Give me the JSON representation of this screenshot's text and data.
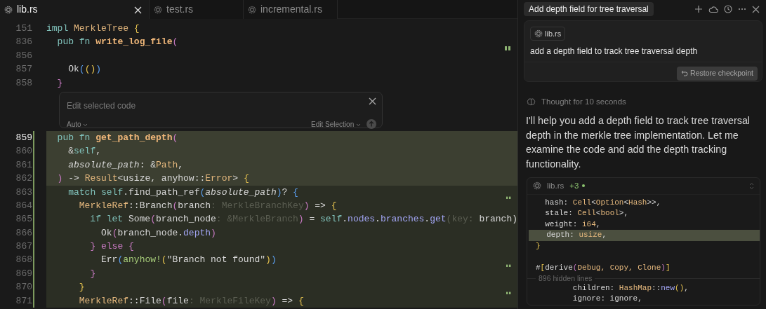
{
  "tabs": [
    {
      "label": "lib.rs",
      "selected": true,
      "closable": true
    },
    {
      "label": "test.rs",
      "selected": false
    },
    {
      "label": "incremental.rs",
      "selected": false
    }
  ],
  "editor": {
    "lines_before": [
      {
        "number": "151",
        "tokens": [
          {
            "text": "impl",
            "kind": "kw"
          },
          {
            "text": " MerkleTree",
            "kind": "type"
          },
          {
            "text": " {",
            "kind": "yellow"
          }
        ]
      },
      {
        "number": "836",
        "marker": true,
        "tokens": [
          {
            "text": "  pub",
            "kind": "kw"
          },
          {
            "text": " fn",
            "kind": "kw"
          },
          {
            "text": " write_log_file",
            "kind": "fname"
          },
          {
            "text": "(",
            "kind": "pink"
          }
        ]
      },
      {
        "number": "856"
      },
      {
        "number": "857",
        "tokens": [
          {
            "text": "    Ok"
          },
          {
            "text": "(",
            "kind": "blue"
          },
          {
            "text": "()",
            "kind": "yellow"
          },
          {
            "text": ")",
            "kind": "blue"
          }
        ]
      },
      {
        "number": "858",
        "tokens": [
          {
            "text": "  }",
            "kind": "pink"
          }
        ]
      }
    ],
    "inline_edit": {
      "placeholder": "Edit selected code",
      "model": "Auto",
      "mode": "Edit Selection"
    },
    "lines_after": [
      {
        "number": "859",
        "current": true,
        "selected": true,
        "changed": true,
        "tokens": [
          {
            "text": "  pub",
            "kind": "kw"
          },
          {
            "text": " fn",
            "kind": "kw"
          },
          {
            "text": " get_path_depth",
            "kind": "fname"
          },
          {
            "text": "(",
            "kind": "pink"
          }
        ]
      },
      {
        "number": "860",
        "selected": true,
        "changed": true,
        "tokens": [
          {
            "text": "    &"
          },
          {
            "text": "self",
            "kind": "kw"
          },
          {
            "text": ","
          }
        ]
      },
      {
        "number": "861",
        "selected": true,
        "changed": true,
        "tokens": [
          {
            "text": "    absolute_path",
            "kind": "param"
          },
          {
            "text": ": &"
          },
          {
            "text": "Path",
            "kind": "type"
          },
          {
            "text": ","
          }
        ]
      },
      {
        "number": "862",
        "selected": true,
        "changed": true,
        "tokens": [
          {
            "text": "  )",
            "kind": "pink"
          },
          {
            "text": " -> "
          },
          {
            "text": "Result",
            "kind": "type"
          },
          {
            "text": "<usize, anyhow::"
          },
          {
            "text": "Error",
            "kind": "type"
          },
          {
            "text": "> "
          },
          {
            "text": "{",
            "kind": "yellow"
          }
        ]
      },
      {
        "number": "863",
        "selected": false,
        "changed": true,
        "marker": true,
        "tokens": [
          {
            "text": "    match",
            "kind": "kw"
          },
          {
            "text": " self",
            "kind": "kw"
          },
          {
            "text": ".find_path_ref"
          },
          {
            "text": "(",
            "kind": "blue"
          },
          {
            "text": "absolute_path",
            "kind": "param"
          },
          {
            "text": ")",
            "kind": "blue"
          },
          {
            "text": "? "
          },
          {
            "text": "{",
            "kind": "blue"
          }
        ]
      },
      {
        "number": "864",
        "selected": false,
        "changed": true,
        "tokens": [
          {
            "text": "      MerkleRef",
            "kind": "type"
          },
          {
            "text": "::Branch"
          },
          {
            "text": "(",
            "kind": "pink"
          },
          {
            "text": "branch"
          },
          {
            "text": ": MerkleBranchKey",
            "kind": "hint"
          },
          {
            "text": ")",
            "kind": "pink"
          },
          {
            "text": " => "
          },
          {
            "text": "{",
            "kind": "yellow"
          }
        ]
      },
      {
        "number": "865",
        "selected": false,
        "changed": true,
        "tokens": [
          {
            "text": "        if",
            "kind": "kw"
          },
          {
            "text": " let",
            "kind": "kw"
          },
          {
            "text": " Some"
          },
          {
            "text": "(",
            "kind": "pink"
          },
          {
            "text": "branch_node"
          },
          {
            "text": ": &MerkleBranch",
            "kind": "hint"
          },
          {
            "text": ")",
            "kind": "pink"
          },
          {
            "text": " = "
          },
          {
            "text": "self",
            "kind": "kw"
          },
          {
            "text": "."
          },
          {
            "text": "nodes",
            "kind": "method"
          },
          {
            "text": "."
          },
          {
            "text": "branches",
            "kind": "method"
          },
          {
            "text": "."
          },
          {
            "text": "get",
            "kind": "method"
          },
          {
            "text": "(",
            "kind": "hint"
          },
          {
            "text": "key: ",
            "kind": "hint"
          },
          {
            "text": "branch)"
          }
        ]
      },
      {
        "number": "866",
        "selected": false,
        "changed": true,
        "tokens": [
          {
            "text": "          Ok"
          },
          {
            "text": "(",
            "kind": "pink"
          },
          {
            "text": "branch_node."
          },
          {
            "text": "depth",
            "kind": "method"
          },
          {
            "text": ")",
            "kind": "pink"
          }
        ]
      },
      {
        "number": "867",
        "selected": false,
        "changed": true,
        "tokens": [
          {
            "text": "        } else {",
            "kind": "pink"
          }
        ]
      },
      {
        "number": "868",
        "selected": false,
        "changed": true,
        "marker": true,
        "tokens": [
          {
            "text": "          Err"
          },
          {
            "text": "(",
            "kind": "blue"
          },
          {
            "text": "anyhow!",
            "kind": "macro"
          },
          {
            "text": "(",
            "kind": "yellow"
          },
          {
            "text": "\"Branch not found\""
          },
          {
            "text": ")",
            "kind": "yellow"
          },
          {
            "text": ")",
            "kind": "blue"
          }
        ]
      },
      {
        "number": "869",
        "selected": false,
        "changed": true,
        "tokens": [
          {
            "text": "        }",
            "kind": "pink"
          }
        ]
      },
      {
        "number": "870",
        "selected": false,
        "changed": true,
        "marker": true,
        "tokens": [
          {
            "text": "      }",
            "kind": "yellow"
          }
        ]
      },
      {
        "number": "871",
        "selected": false,
        "changed": true,
        "tokens": [
          {
            "text": "      MerkleRef",
            "kind": "type"
          },
          {
            "text": "::File"
          },
          {
            "text": "(",
            "kind": "pink"
          },
          {
            "text": "file"
          },
          {
            "text": ": MerkleFileKey",
            "kind": "hint"
          },
          {
            "text": ")",
            "kind": "pink"
          },
          {
            "text": " => "
          },
          {
            "text": "{",
            "kind": "yellow"
          }
        ]
      }
    ]
  },
  "chat": {
    "title": "Add depth field for tree traversal",
    "user_message": {
      "file_chip": "lib.rs",
      "text": "add a depth field to track tree traversal depth",
      "restore_button": "Restore checkpoint"
    },
    "thought": "Thought for 10 seconds",
    "reply": "I'll help you add a depth field to track tree traversal depth in the merkle tree implementation. Let me examine the code and add the depth tracking functionality.",
    "diff_card": {
      "file": "lib.rs",
      "additions": "+3",
      "lines": [
        {
          "kind": "code",
          "tokens": [
            {
              "text": "  hash: "
            },
            {
              "text": "Cell",
              "kind": "type"
            },
            {
              "text": "<"
            },
            {
              "text": "Option",
              "kind": "type"
            },
            {
              "text": "<"
            },
            {
              "text": "Hash",
              "kind": "type"
            },
            {
              "text": ">>,"
            }
          ]
        },
        {
          "kind": "code",
          "tokens": [
            {
              "text": "  stale: "
            },
            {
              "text": "Cell",
              "kind": "type"
            },
            {
              "text": "<"
            },
            {
              "text": "bool",
              "kind": "type"
            },
            {
              "text": ">,"
            }
          ]
        },
        {
          "kind": "code",
          "tokens": [
            {
              "text": "  weight: "
            },
            {
              "text": "i64",
              "kind": "type"
            },
            {
              "text": ","
            }
          ]
        },
        {
          "kind": "code",
          "added": true,
          "tokens": [
            {
              "text": "  depth: "
            },
            {
              "text": "usize",
              "kind": "type"
            },
            {
              "text": ","
            }
          ]
        },
        {
          "kind": "code",
          "tokens": [
            {
              "text": "}",
              "kind": "yellow"
            }
          ]
        },
        {
          "kind": "code"
        },
        {
          "kind": "code",
          "tokens": [
            {
              "text": "#"
            },
            {
              "text": "[",
              "kind": "yellow"
            },
            {
              "text": "derive"
            },
            {
              "text": "(",
              "kind": "pink"
            },
            {
              "text": "Debug, Copy, Clone",
              "kind": "type"
            },
            {
              "text": ")",
              "kind": "pink"
            },
            {
              "text": "]",
              "kind": "yellow"
            }
          ]
        },
        {
          "kind": "fold",
          "text": "896 hidden lines"
        },
        {
          "kind": "code",
          "tokens": [
            {
              "text": "        children: "
            },
            {
              "text": "HashMap",
              "kind": "type"
            },
            {
              "text": "::"
            },
            {
              "text": "new",
              "kind": "method"
            },
            {
              "text": "()",
              "kind": "yellow"
            },
            {
              "text": ","
            }
          ]
        },
        {
          "kind": "code",
          "tokens": [
            {
              "text": "        ignore: ignore,"
            }
          ]
        }
      ]
    }
  }
}
